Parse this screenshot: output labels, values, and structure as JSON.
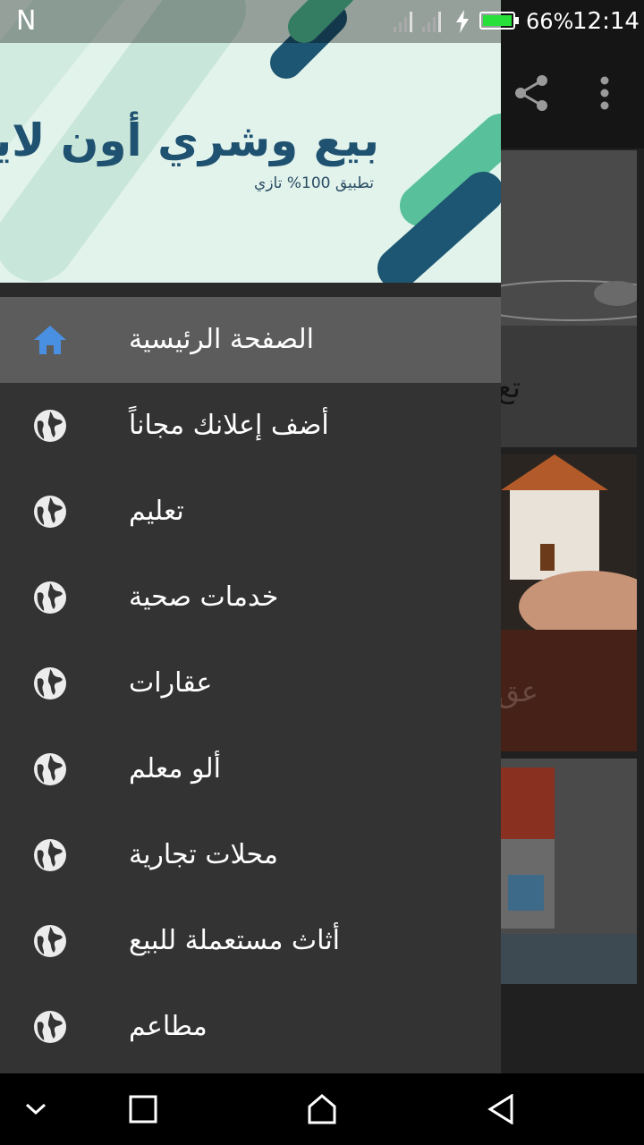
{
  "status_bar": {
    "notification_icon": "N",
    "battery_percent": "66%",
    "time": "12:14",
    "battery_color": "#27e03a"
  },
  "background_app": {
    "toolbar_icons": [
      "share-icon",
      "more-vert-icon"
    ],
    "card_labels": [
      "تع",
      "عق",
      ""
    ]
  },
  "drawer": {
    "header": {
      "title": "بيع وشري أون لاين",
      "subtitle": "تطبيق 100% تازي"
    },
    "items": [
      {
        "label": "الصفحة الرئيسية",
        "icon": "home-icon",
        "active": true
      },
      {
        "label": "أضف إعلانك مجاناً",
        "icon": "globe-icon",
        "active": false
      },
      {
        "label": "تعليم",
        "icon": "globe-icon",
        "active": false
      },
      {
        "label": "خدمات صحية",
        "icon": "globe-icon",
        "active": false
      },
      {
        "label": "عقارات",
        "icon": "globe-icon",
        "active": false
      },
      {
        "label": "ألو معلم",
        "icon": "globe-icon",
        "active": false
      },
      {
        "label": "محلات تجارية",
        "icon": "globe-icon",
        "active": false
      },
      {
        "label": "أثاث مستعملة للبيع",
        "icon": "globe-icon",
        "active": false
      },
      {
        "label": "مطاعم",
        "icon": "globe-icon",
        "active": false
      }
    ]
  },
  "nav_bar": {
    "buttons": [
      "collapse-icon",
      "recents-icon",
      "home-icon",
      "back-icon"
    ]
  },
  "colors": {
    "header_bg": "#e2f3ec",
    "header_text": "#1f5170",
    "drawer_bg": "#333333",
    "active_item_bg": "#5c5c5c",
    "home_icon": "#4a90e2"
  }
}
